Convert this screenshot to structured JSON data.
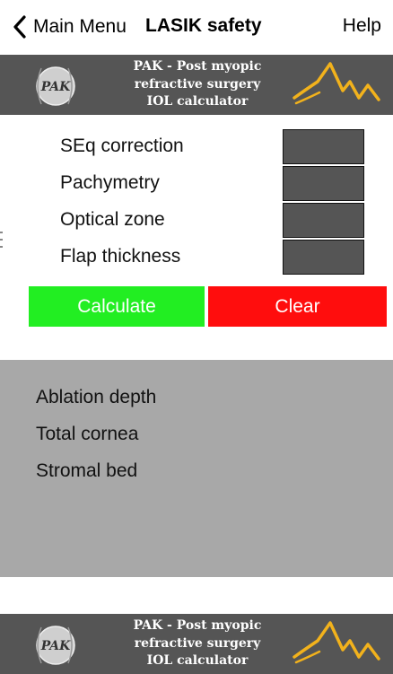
{
  "navbar": {
    "back_label": "Main Menu",
    "title": "LASIK safety",
    "help_label": "Help"
  },
  "banner": {
    "logo_text": "PAK",
    "lines": [
      "PAK - Post myopic",
      "refractive surgery",
      "IOL calculator"
    ],
    "icons": [
      "pak-logo",
      "mountain-logo"
    ]
  },
  "inputs": [
    {
      "label": "SEq correction",
      "value": ""
    },
    {
      "label": "Pachymetry",
      "value": ""
    },
    {
      "label": "Optical zone",
      "value": ""
    },
    {
      "label": "Flap thickness",
      "value": ""
    }
  ],
  "buttons": {
    "calculate_label": "Calculate",
    "clear_label": "Clear"
  },
  "results": [
    {
      "label": "Ablation depth"
    },
    {
      "label": "Total cornea"
    },
    {
      "label": "Stromal bed"
    }
  ],
  "colors": {
    "banner_bg": "#555555",
    "field_bg": "#555555",
    "calculate": "#22ee22",
    "clear": "#ff0d0d",
    "results_bg": "#a8a8a8",
    "mountain": "#f2b21c"
  }
}
